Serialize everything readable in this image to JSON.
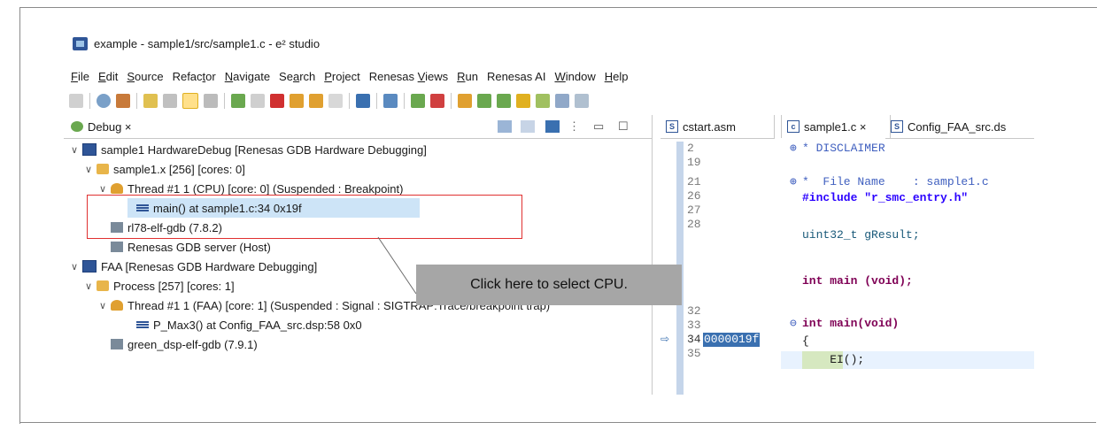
{
  "window": {
    "title": "example - sample1/src/sample1.c - e² studio"
  },
  "menu": [
    "File",
    "Edit",
    "Source",
    "Refactor",
    "Navigate",
    "Search",
    "Project",
    "Renesas Views",
    "Run",
    "Renesas AI",
    "Window",
    "Help"
  ],
  "debug_view": {
    "tab_label": "Debug ×",
    "tree": [
      "sample1 HardwareDebug [Renesas GDB Hardware Debugging]",
      "sample1.x [256] [cores: 0]",
      "Thread #1 1 (CPU) [core: 0] (Suspended : Breakpoint)",
      "main() at sample1.c:34 0x19f",
      "rl78-elf-gdb (7.8.2)",
      "Renesas GDB server (Host)",
      "FAA [Renesas GDB Hardware Debugging]",
      "Process [257] [cores: 1]",
      "Thread #1 1 (FAA) [core: 1] (Suspended : Signal : SIGTRAP:Trace/breakpoint trap)",
      "P_Max3() at Config_FAA_src.dsp:58 0x0",
      "green_dsp-elf-gdb (7.9.1)"
    ]
  },
  "editor_tabs": {
    "left": "cstart.asm",
    "middle": "sample1.c ×",
    "right": "Config_FAA_src.ds"
  },
  "line_numbers": [
    "2",
    "19",
    "21",
    "26",
    "27",
    "28",
    "",
    "",
    "32",
    "33",
    "34",
    "35"
  ],
  "address_label": "0000019f",
  "code": {
    "disclaimer": "* DISCLAIMER",
    "file_name": "*  File Name    : sample1.c",
    "include": "#include \"r_smc_entry.h\"",
    "global": "uint32_t gResult;",
    "proto": "int main (void);",
    "def": "int main(void)",
    "brace": "{",
    "ei": "    EI();"
  },
  "callout": {
    "text": "Click here to select CPU."
  }
}
